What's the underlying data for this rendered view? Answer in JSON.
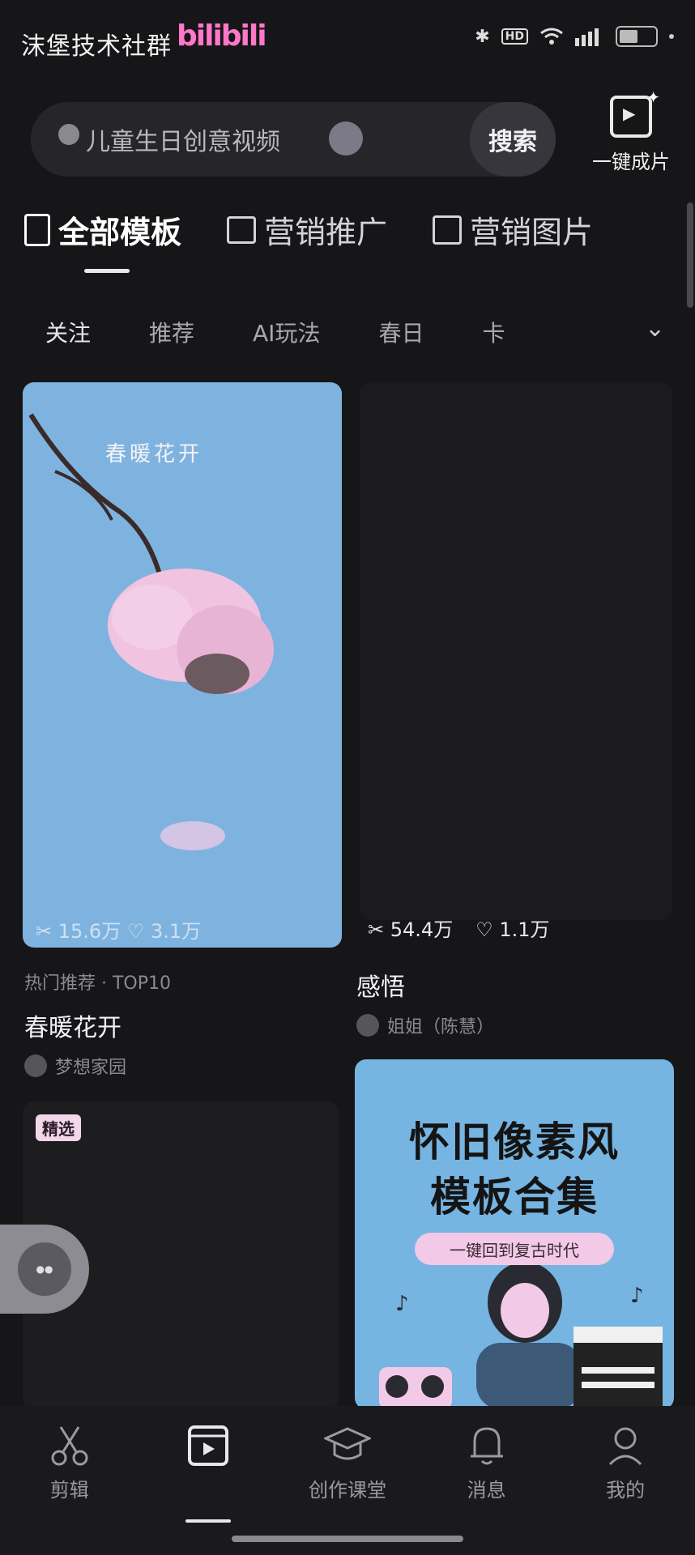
{
  "status_bar": {
    "watermark": "沫堡技术社群",
    "logo_text": "bilibili"
  },
  "search": {
    "placeholder": "儿童生日创意视频",
    "button": "搜索",
    "one_click": "一键成片"
  },
  "category_tabs": [
    {
      "label": "全部模板",
      "active": true
    },
    {
      "label": "营销推广",
      "active": false
    },
    {
      "label": "营销图片",
      "active": false
    }
  ],
  "sub_tabs": [
    {
      "label": "关注",
      "active": true
    },
    {
      "label": "推荐",
      "active": false
    },
    {
      "label": "AI玩法",
      "active": false
    },
    {
      "label": "春日",
      "active": false
    },
    {
      "label": "卡",
      "active": false
    }
  ],
  "cards": [
    {
      "thumb_text": "春暖花开",
      "meta": "热门推荐 · TOP10",
      "name": "春暖花开",
      "author": "梦想家园",
      "stats": {
        "uses": "15.6万",
        "likes": "3.1万"
      }
    },
    {
      "name": "感悟",
      "author": "姐姐（陈慧）",
      "stats": {
        "uses": "54.4万",
        "likes": "1.1万"
      }
    },
    {
      "badge": "精选"
    },
    {
      "title_line1": "怀旧像素风",
      "title_line2": "模板合集",
      "subtitle": "一键回到复古时代"
    }
  ],
  "bottom_nav": [
    {
      "label": "剪辑",
      "icon": "scissors-icon",
      "active": false
    },
    {
      "label": "",
      "icon": "template-play-icon",
      "active": true
    },
    {
      "label": "创作课堂",
      "icon": "graduation-cap-icon",
      "active": false
    },
    {
      "label": "消息",
      "icon": "bell-icon",
      "active": false
    },
    {
      "label": "我的",
      "icon": "profile-icon",
      "active": false
    }
  ],
  "colors": {
    "background": "#161618",
    "sky_blue": "#7fb3df",
    "blossom_pink": "#f2c9e6"
  }
}
